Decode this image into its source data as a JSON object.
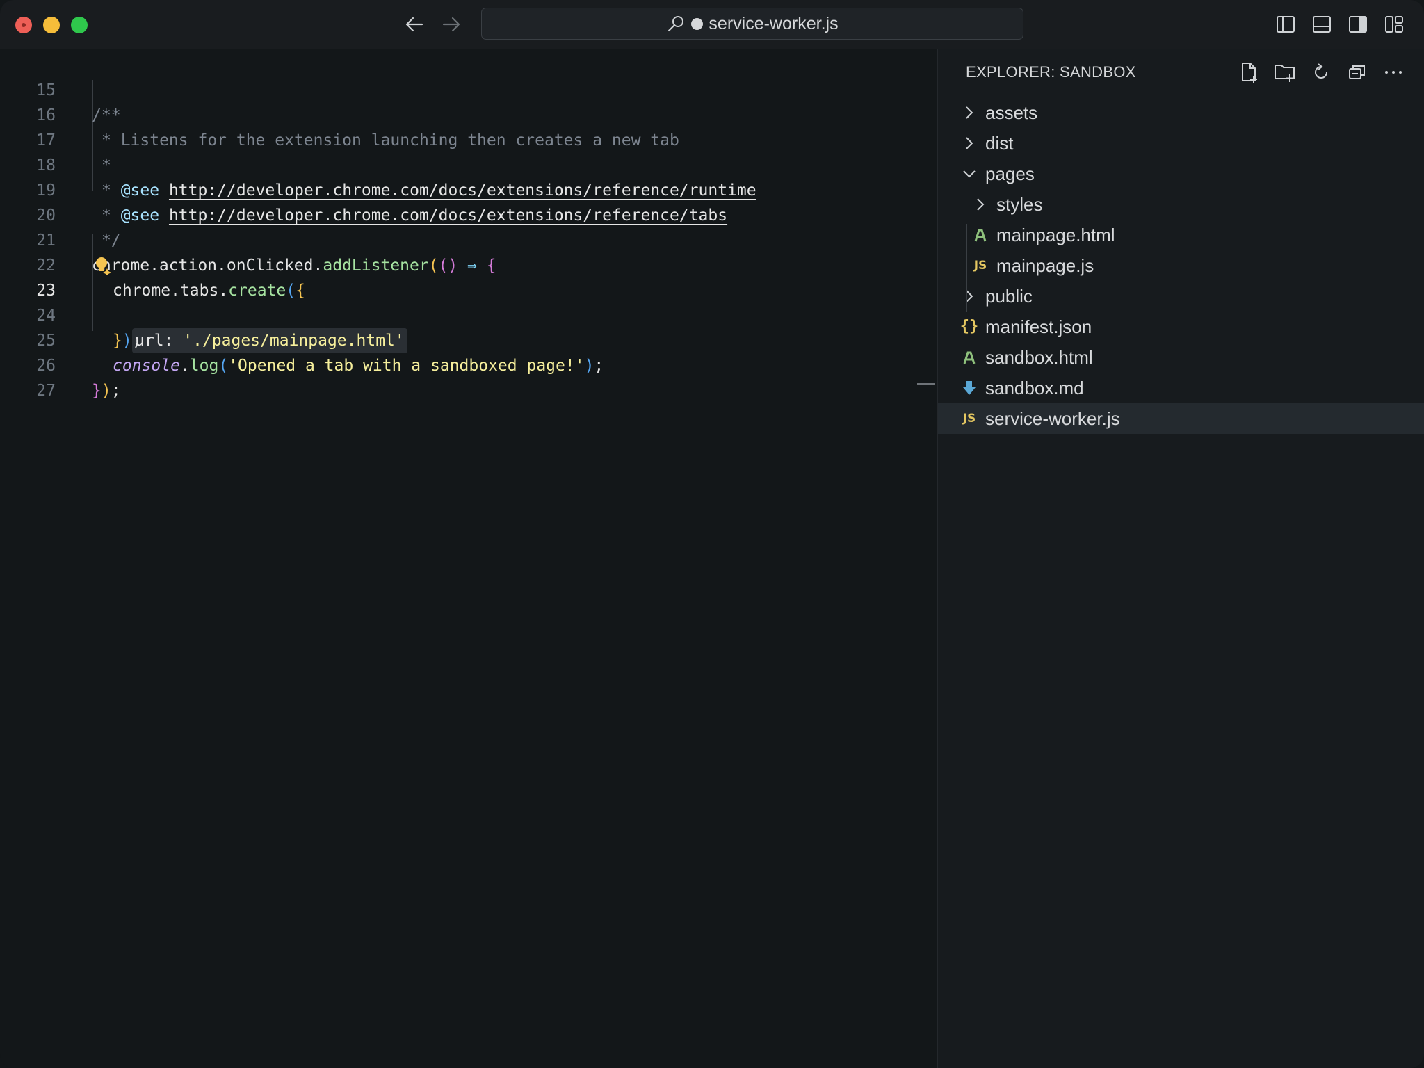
{
  "titlebar": {
    "search_text": "service-worker.js",
    "back_icon": "arrow-left-icon",
    "forward_icon": "arrow-right-icon"
  },
  "editor": {
    "active_line": "23",
    "lines": [
      {
        "num": "15"
      },
      {
        "num": "16"
      },
      {
        "num": "17"
      },
      {
        "num": "18"
      },
      {
        "num": "19"
      },
      {
        "num": "20"
      },
      {
        "num": "21"
      },
      {
        "num": "22"
      },
      {
        "num": "23"
      },
      {
        "num": "24"
      },
      {
        "num": "25"
      },
      {
        "num": "26"
      },
      {
        "num": "27"
      }
    ],
    "tokens": {
      "l15": "/**",
      "l16": "* Listens for the extension launching then creates a new tab",
      "l17": "*",
      "l18_star": "* ",
      "l18_tag": "@see",
      "l18_link": "http://developer.chrome.com/docs/extensions/reference/runtime",
      "l19_star": "* ",
      "l19_tag": "@see",
      "l19_link": "http://developer.chrome.com/docs/extensions/reference/tabs",
      "l20": "*/",
      "l21_obj": "chrome.action.onClicked.",
      "l21_fn": "addListener",
      "l21_p1": "(",
      "l21_p2": "()",
      "l21_arrow": " ⇒ ",
      "l21_brace": "{",
      "l22_obj": "chrome.tabs.",
      "l22_fn": "create",
      "l22_p": "(",
      "l22_brace": "{",
      "l23_key": "url:",
      "l23_val": "'./pages/mainpage.html'",
      "l24_brace": "}",
      "l24_p": ")",
      "l24_semi": ";",
      "l25_obj": "console",
      "l25_dot": ".",
      "l25_fn": "log",
      "l25_p1": "(",
      "l25_str": "'Opened a tab with a sandboxed page!'",
      "l25_p2": ")",
      "l25_semi": ";",
      "l26_brace": "}",
      "l26_p": ")",
      "l26_semi": ";"
    }
  },
  "sidebar": {
    "title": "EXPLORER: SANDBOX",
    "actions": [
      "new-file-icon",
      "new-folder-icon",
      "refresh-icon",
      "collapse-all-icon",
      "more-icon"
    ],
    "items": [
      {
        "label": "assets",
        "type": "folder",
        "expanded": false
      },
      {
        "label": "dist",
        "type": "folder",
        "expanded": false
      },
      {
        "label": "pages",
        "type": "folder",
        "expanded": true
      },
      {
        "label": "styles",
        "type": "folder",
        "expanded": false
      },
      {
        "label": "mainpage.html",
        "type": "html"
      },
      {
        "label": "mainpage.js",
        "type": "js",
        "badge": "JS"
      },
      {
        "label": "public",
        "type": "folder",
        "expanded": false
      },
      {
        "label": "manifest.json",
        "type": "json",
        "badge": "{}"
      },
      {
        "label": "sandbox.html",
        "type": "html"
      },
      {
        "label": "sandbox.md",
        "type": "md"
      },
      {
        "label": "service-worker.js",
        "type": "js",
        "badge": "JS",
        "selected": true
      }
    ]
  },
  "colors": {
    "background": "#131719",
    "sidebar": "#171b1e",
    "selected_row": "#242a2f",
    "js_badge": "#e4c761",
    "html_icon": "#8ec07c",
    "md_icon": "#5ba8d6"
  }
}
